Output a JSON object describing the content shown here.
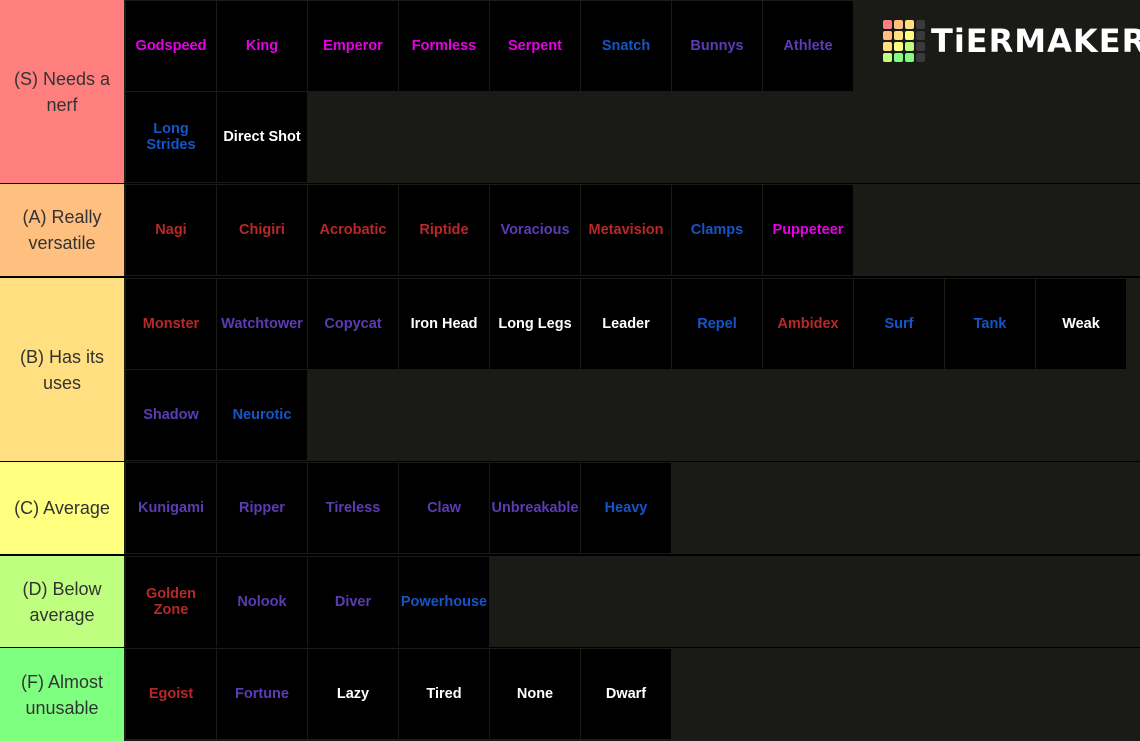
{
  "logo": {
    "text": "TiERMAKER",
    "grid_colors": [
      "#ff7f7f",
      "#ffbf7f",
      "#ffdf7f",
      "#3a3a3a",
      "#ffbf7f",
      "#ffdf7f",
      "#ffff7f",
      "#3a3a3a",
      "#ffdf7f",
      "#ffff7f",
      "#bfff7f",
      "#3a3a3a",
      "#bfff7f",
      "#7fff7f",
      "#7fff7f",
      "#3a3a3a"
    ]
  },
  "colors": {
    "magenta": "#e600e6",
    "blue": "#1455c8",
    "purple": "#5a3cb4",
    "red": "#b92828",
    "white": "#ffffff",
    "row_bg": "#1a1a17"
  },
  "tiers": [
    {
      "label": "(S) Needs a nerf",
      "color": "#ff7f7f",
      "items": [
        {
          "text": "Godspeed",
          "color": "magenta"
        },
        {
          "text": "King",
          "color": "magenta"
        },
        {
          "text": "Emperor",
          "color": "magenta"
        },
        {
          "text": "Formless",
          "color": "magenta"
        },
        {
          "text": "Serpent",
          "color": "magenta"
        },
        {
          "text": "Snatch",
          "color": "blue"
        },
        {
          "text": "Bunnys",
          "color": "purple"
        },
        {
          "text": "Athlete",
          "color": "purple"
        },
        {
          "text": "Long Strides",
          "color": "blue"
        },
        {
          "text": "Direct Shot",
          "color": "white"
        }
      ]
    },
    {
      "label": "(A) Really versatile",
      "color": "#ffbf7f",
      "items": [
        {
          "text": "Nagi",
          "color": "red"
        },
        {
          "text": "Chigiri",
          "color": "red"
        },
        {
          "text": "Acrobatic",
          "color": "red"
        },
        {
          "text": "Riptide",
          "color": "red"
        },
        {
          "text": "Voracious",
          "color": "purple"
        },
        {
          "text": "Metavision",
          "color": "red"
        },
        {
          "text": "Clamps",
          "color": "blue"
        },
        {
          "text": "Puppeteer",
          "color": "magenta"
        }
      ]
    },
    {
      "label": "(B) Has its uses",
      "color": "#ffdf7f",
      "items": [
        {
          "text": "Monster",
          "color": "red"
        },
        {
          "text": "Watchtower",
          "color": "purple"
        },
        {
          "text": "Copycat",
          "color": "purple"
        },
        {
          "text": "Iron Head",
          "color": "white"
        },
        {
          "text": "Long Legs",
          "color": "white"
        },
        {
          "text": "Leader",
          "color": "white"
        },
        {
          "text": "Repel",
          "color": "blue"
        },
        {
          "text": "Ambidex",
          "color": "red"
        },
        {
          "text": "Surf",
          "color": "blue"
        },
        {
          "text": "Tank",
          "color": "blue"
        },
        {
          "text": "Weak",
          "color": "white"
        },
        {
          "text": "Shadow",
          "color": "purple"
        },
        {
          "text": "Neurotic",
          "color": "blue"
        }
      ]
    },
    {
      "label": "(C) Average",
      "color": "#ffff7f",
      "items": [
        {
          "text": "Kunigami",
          "color": "purple"
        },
        {
          "text": "Ripper",
          "color": "purple"
        },
        {
          "text": "Tireless",
          "color": "purple"
        },
        {
          "text": "Claw",
          "color": "purple"
        },
        {
          "text": "Unbreakable",
          "color": "purple"
        },
        {
          "text": "Heavy",
          "color": "blue"
        }
      ]
    },
    {
      "label": "(D) Below average",
      "color": "#bfff7f",
      "items": [
        {
          "text": "Golden Zone",
          "color": "red"
        },
        {
          "text": "Nolook",
          "color": "purple"
        },
        {
          "text": "Diver",
          "color": "purple"
        },
        {
          "text": "Powerhouse",
          "color": "blue"
        }
      ]
    },
    {
      "label": "(F) Almost unusable",
      "color": "#7fff7f",
      "items": [
        {
          "text": "Egoist",
          "color": "red"
        },
        {
          "text": "Fortune",
          "color": "purple"
        },
        {
          "text": "Lazy",
          "color": "white"
        },
        {
          "text": "Tired",
          "color": "white"
        },
        {
          "text": "None",
          "color": "white"
        },
        {
          "text": "Dwarf",
          "color": "white"
        }
      ]
    }
  ]
}
